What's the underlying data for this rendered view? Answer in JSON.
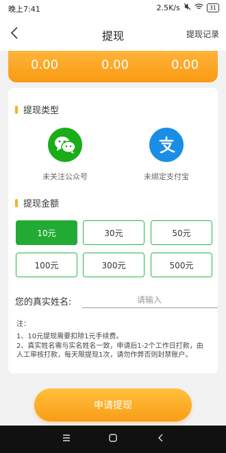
{
  "status": {
    "time": "晚上7:41",
    "speed": "2.5K/s",
    "battery": "31"
  },
  "nav": {
    "title": "提现",
    "records": "提现记录"
  },
  "balances": [
    "0.00",
    "0.00",
    "0.00"
  ],
  "withdraw_type": {
    "title": "提现类型",
    "options": [
      {
        "label": "未关注公众号",
        "icon": "wechat-icon",
        "color": "#1aad19"
      },
      {
        "label": "未绑定支付宝",
        "icon": "alipay-icon",
        "color": "#1a8ee6"
      }
    ]
  },
  "amount": {
    "title": "提现金额",
    "options": [
      "10元",
      "30元",
      "50元",
      "100元",
      "300元",
      "500元"
    ],
    "selected": "10元"
  },
  "name_field": {
    "label": "您的真实姓名:",
    "placeholder": "请输入"
  },
  "notes": {
    "heading": "注：",
    "lines": [
      "1、10元提现需要扣除1元手续费。",
      "2、真实姓名需与实名姓名一致，申请后1-2个工作日打款，由人工审核打款，每天限提现1次，请勿作弊否则封禁账户。"
    ]
  },
  "submit_label": "申请提现",
  "colors": {
    "accent_orange": "#f99a12",
    "accent_green": "#22ab34",
    "bar_yellow": "#f7b21d"
  }
}
